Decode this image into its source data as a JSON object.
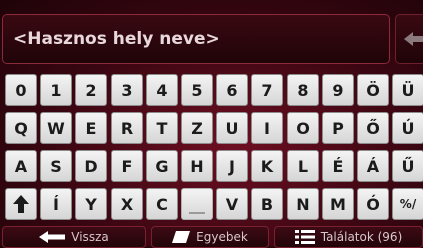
{
  "search": {
    "placeholder": "<Hasznos hely neve>"
  },
  "keyboard": {
    "row1": [
      "0",
      "1",
      "2",
      "3",
      "4",
      "5",
      "6",
      "7",
      "8",
      "9",
      "Ö",
      "Ü"
    ],
    "row2": [
      "Q",
      "W",
      "E",
      "R",
      "T",
      "Z",
      "U",
      "I",
      "O",
      "P",
      "Ő",
      "Ú"
    ],
    "row3": [
      "A",
      "S",
      "D",
      "F",
      "G",
      "H",
      "J",
      "K",
      "L",
      "É",
      "Á",
      "Ű"
    ],
    "row4": [
      "Í",
      "Y",
      "X",
      "C",
      "V",
      "B",
      "N",
      "M",
      "Ó",
      "%/"
    ]
  },
  "footer": {
    "back_label": "Vissza",
    "other_label": "Egyebek",
    "results_label": "Találatok (96)"
  },
  "icons": {
    "back": "arrow-left-icon",
    "other": "keyboard-layout-icon",
    "results": "list-icon",
    "shift": "shift-arrow-icon",
    "backspace": "backspace-icon"
  }
}
